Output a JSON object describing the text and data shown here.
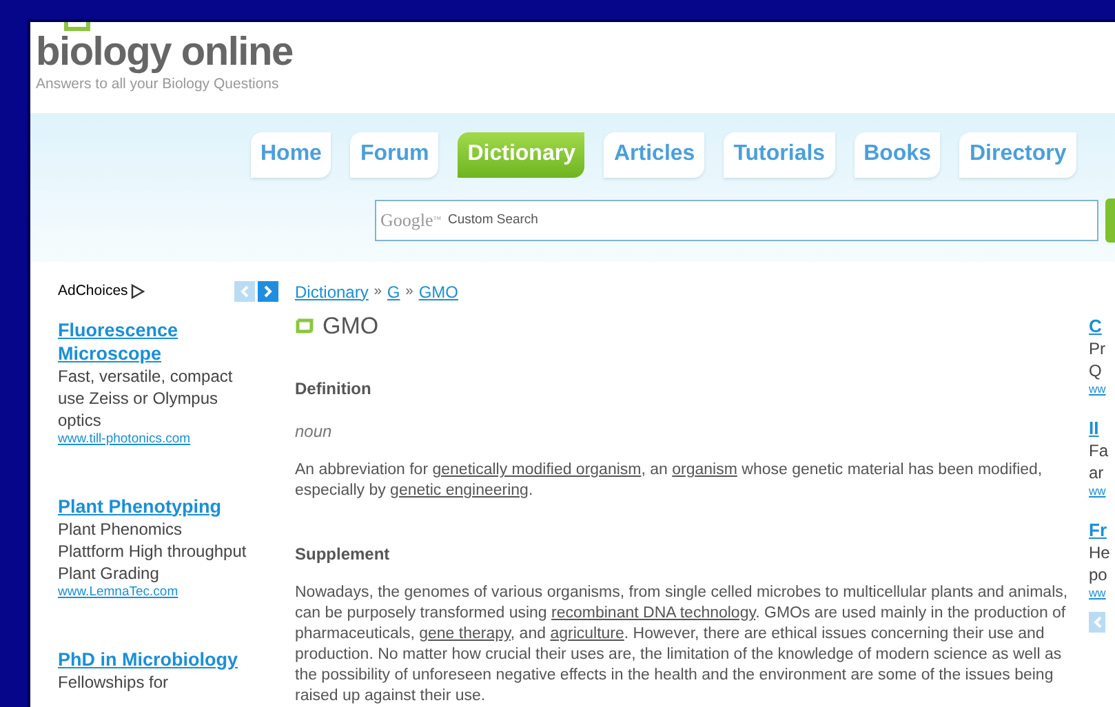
{
  "site": {
    "logo": "biology online",
    "tagline": "Answers to all your Biology Questions"
  },
  "nav": [
    {
      "label": "Home",
      "selected": false
    },
    {
      "label": "Forum",
      "selected": false
    },
    {
      "label": "Dictionary",
      "selected": true
    },
    {
      "label": "Articles",
      "selected": false
    },
    {
      "label": "Tutorials",
      "selected": false
    },
    {
      "label": "Books",
      "selected": false
    },
    {
      "label": "Directory",
      "selected": false
    }
  ],
  "search": {
    "brand": "Google",
    "brand_mark": "™",
    "placeholder": "Custom Search"
  },
  "left_ads": {
    "label": "AdChoices",
    "ads": [
      {
        "title": "Fluorescence Microscope",
        "text": "Fast, versatile, compact use Zeiss or Olympus optics",
        "url": "www.till-photonics.com"
      },
      {
        "title": "Plant Phenotyping",
        "text": "Plant Phenomics Plattform High throughput Plant Grading",
        "url": "www.LemnaTec.com"
      },
      {
        "title": "PhD in Microbiology",
        "text": "Fellowships for"
      }
    ]
  },
  "breadcrumb": [
    "Dictionary",
    "G",
    "GMO"
  ],
  "breadcrumb_separator": "»",
  "title": "GMO",
  "sections": [
    {
      "heading": "Definition",
      "kind": "definition",
      "part_of_speech": "noun",
      "body": [
        {
          "text": "An abbreviation for "
        },
        {
          "text": "genetically modified organism",
          "link": true
        },
        {
          "text": ", an "
        },
        {
          "text": "organism",
          "link": true
        },
        {
          "text": " whose genetic material has been modified, especially by "
        },
        {
          "text": "genetic engineering",
          "link": true
        },
        {
          "text": "."
        }
      ]
    },
    {
      "heading": "Supplement",
      "kind": "supplement",
      "body": [
        {
          "text": "Nowadays, the genomes of various organisms, from single celled microbes to multicellular plants and animals, can be purposely transformed using "
        },
        {
          "text": "recombinant DNA technology",
          "link": true
        },
        {
          "text": ". GMOs are used mainly in the production of pharmaceuticals, "
        },
        {
          "text": "gene therapy",
          "link": true
        },
        {
          "text": ", and "
        },
        {
          "text": "agriculture",
          "link": true
        },
        {
          "text": ". However, there are ethical issues concerning their use and production. No matter how crucial their uses are, the limitation of the knowledge of modern science as well as the possibility of unforeseen negative effects in the health and the environment are some of the issues being raised up against their use."
        }
      ]
    }
  ],
  "right_ads": [
    {
      "title": "C",
      "lines": [
        "Pr",
        "Q"
      ],
      "url": "ww"
    },
    {
      "title": "II",
      "lines": [
        "Fa",
        "ar"
      ],
      "url": "ww"
    },
    {
      "title": "Fr",
      "lines": [
        "He",
        "po"
      ],
      "url": "ww"
    }
  ]
}
